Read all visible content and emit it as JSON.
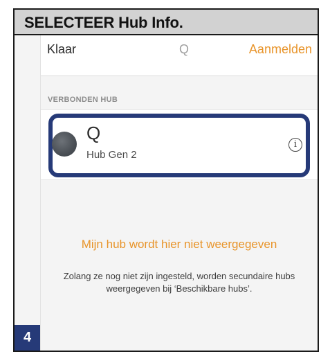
{
  "header": {
    "title": "SELECTEER Hub Info."
  },
  "topbar": {
    "left_label": "Klaar",
    "center_label": "Q",
    "right_label": "Aanmelden"
  },
  "section": {
    "label": "VERBONDEN HUB"
  },
  "hub": {
    "name": "Q",
    "model": "Hub Gen 2",
    "info_symbol": "i"
  },
  "links": {
    "missing_hub": "Mijn hub wordt hier niet weergegeven"
  },
  "note": {
    "text": "Zolang ze nog niet zijn ingesteld, worden secundaire hubs weergegeven bij ‘Beschikbare hubs’."
  },
  "step": {
    "number": "4"
  },
  "colors": {
    "accent": "#e8942a",
    "highlight": "#263a78",
    "header_bg": "#d2d2d2"
  }
}
